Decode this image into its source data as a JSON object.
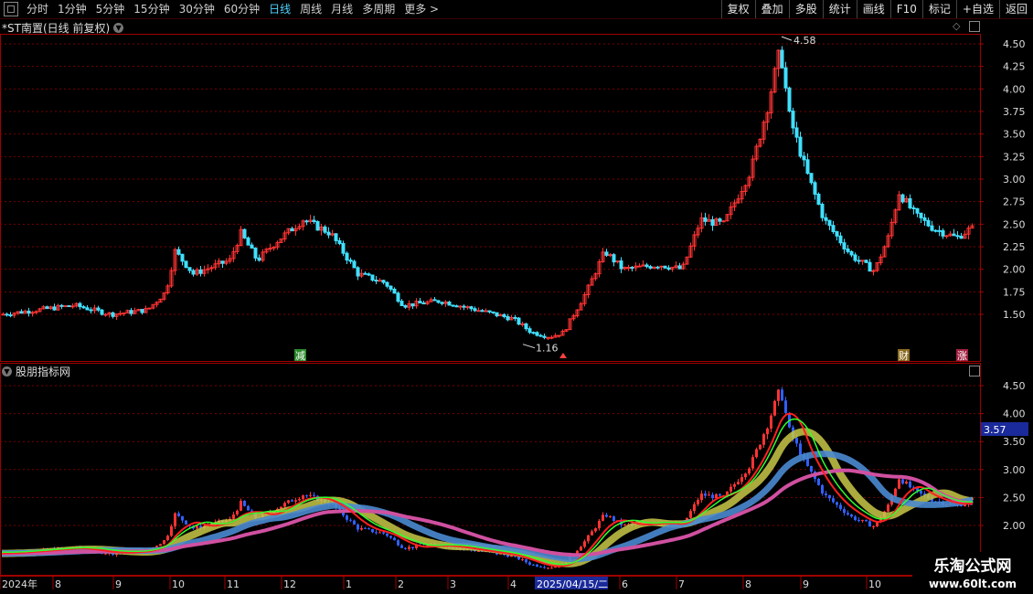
{
  "toolbar": {
    "periods": [
      "分时",
      "1分钟",
      "5分钟",
      "15分钟",
      "30分钟",
      "60分钟",
      "日线",
      "周线",
      "月线",
      "多周期",
      "更多 >"
    ],
    "active_period": "日线",
    "buttons": [
      "复权",
      "叠加",
      "多股",
      "统计",
      "画线",
      "F10",
      "标记",
      "+自选",
      "返回"
    ]
  },
  "main_panel": {
    "title": "*ST南置(日线 前复权)",
    "high_label": "4.58",
    "low_label": "1.16",
    "price_axis": [
      "4.50",
      "4.25",
      "4.00",
      "3.75",
      "3.50",
      "3.25",
      "3.00",
      "2.75",
      "2.50",
      "2.25",
      "2.00",
      "1.75",
      "1.50"
    ],
    "markers": {
      "reduce": "减",
      "finance": "财",
      "rise": "涨"
    }
  },
  "indicator_panel": {
    "title": "股朋指标网",
    "price_axis": [
      "4.50",
      "4.00",
      "3.50",
      "3.00",
      "2.50",
      "2.00"
    ],
    "current_value": "3.57"
  },
  "time_axis": [
    "2024年",
    "8",
    "9",
    "10",
    "11",
    "12",
    "1",
    "2",
    "3",
    "4",
    "6",
    "7",
    "8",
    "9",
    "10"
  ],
  "time_cursor": "2025/04/15/二",
  "watermark": {
    "line1": "乐淘公式网",
    "line2": "www.60lt.com"
  },
  "colors": {
    "up": "#ff3333",
    "down": "#40e0ff",
    "grid": "#7a0000",
    "axis": "#a00000"
  }
}
